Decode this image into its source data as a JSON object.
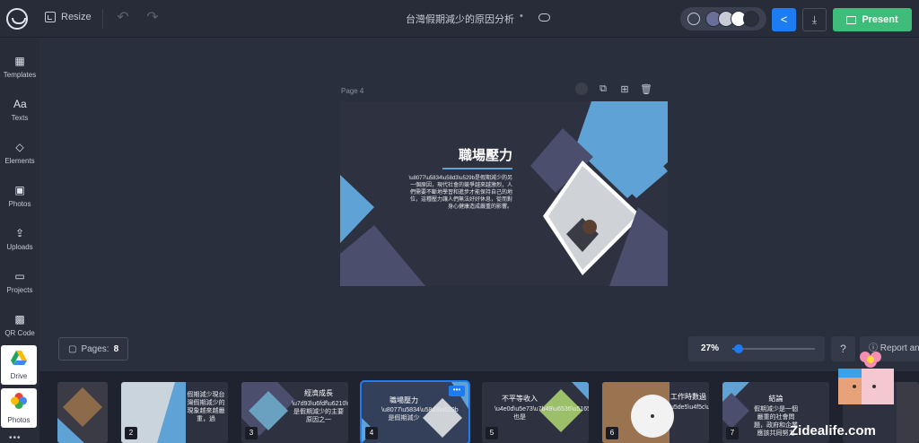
{
  "topbar": {
    "resize_label": "Resize",
    "undo_glyph": "↶",
    "redo_glyph": "↷",
    "doc_title": "台灣假期減少的原因分析",
    "doc_dot": "•",
    "present_label": "Present",
    "share_glyph": "<",
    "download_glyph": "⤓",
    "theme_swatches": [
      "#6a6f9a",
      "#c8cbd6",
      "#ffffff",
      "#2b2f3c"
    ]
  },
  "sidebar": {
    "items": [
      {
        "label": "Templates",
        "glyph": "▦"
      },
      {
        "label": "Texts",
        "glyph": "Aa"
      },
      {
        "label": "Elements",
        "glyph": "◇"
      },
      {
        "label": "Photos",
        "glyph": "▣"
      },
      {
        "label": "Uploads",
        "glyph": "⇪"
      },
      {
        "label": "Projects",
        "glyph": "▭"
      },
      {
        "label": "QR Code",
        "glyph": "▩"
      }
    ],
    "apps": [
      {
        "label": "Drive"
      },
      {
        "label": "Photos"
      }
    ],
    "more_glyph": "•••"
  },
  "canvas": {
    "page_label": "Page 4",
    "slide": {
      "title": "職場壓力",
      "body": "\\u8077\\u5834\\u58d3\\u529b是假期減少的另一個原因，現代社會的競爭越來越激烈，人們需要不斷地學習和進步才能保持自己的地位，這種壓力讓人們無法好好休息，從而對身心健康造成嚴重的影響。"
    }
  },
  "controls": {
    "pages_label": "Pages:",
    "pages_count": "8",
    "zoom_label": "27%",
    "zoom_value": 0.05,
    "help_glyph": "?",
    "report_label": "Report an"
  },
  "filmstrip": {
    "thumbs": [
      {
        "num": "",
        "title": "",
        "text": ""
      },
      {
        "num": "2",
        "title": "",
        "text": "假期減少現台灣假期減少的現象越來越嚴重，過"
      },
      {
        "num": "3",
        "title": "經濟成長",
        "text": "\\u7d93\\u6fdf\\u6210\\u9577是假期減少的主要原因之一"
      },
      {
        "num": "4",
        "title": "職場壓力",
        "text": "\\u8077\\u5834\\u58d3\\u529b是假期減少",
        "more": "•••"
      },
      {
        "num": "5",
        "title": "不平等收入",
        "text": "\\u4e0d\\u5e73\\u7b49\\u6536\\u5165也是"
      },
      {
        "num": "6",
        "title": "工作時數過",
        "text": "\\u5de5\\u4f5c\\u6642\\u6578\\u904e\\u9577"
      },
      {
        "num": "7",
        "title": "結論",
        "text": "假期減少是一個嚴重的社會問題，政府和企業應該共同努力"
      },
      {
        "num": "",
        "title": "",
        "text": ""
      }
    ]
  },
  "watermark": "Zidealife.com"
}
